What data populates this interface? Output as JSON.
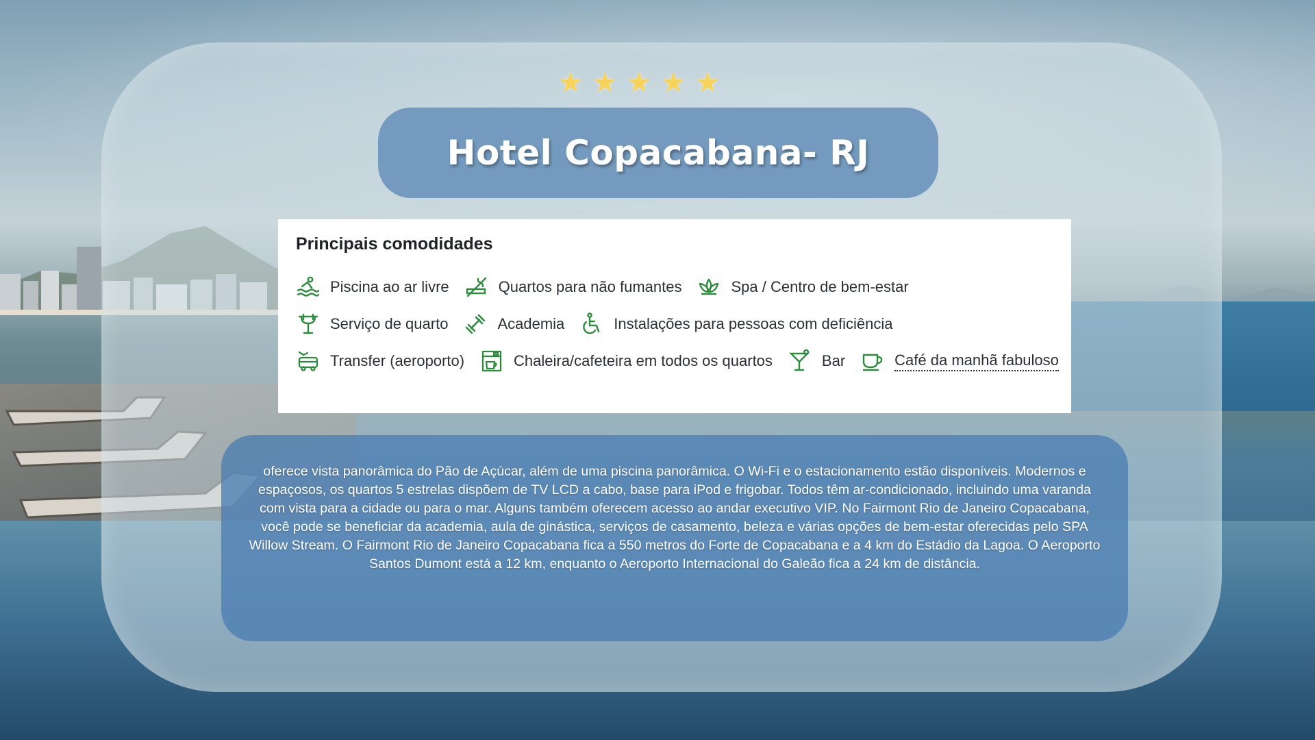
{
  "rating": {
    "stars": 5
  },
  "hotel": {
    "title": "Hotel Copacabana- RJ"
  },
  "amenities": {
    "heading": "Principais comodidades",
    "rows": [
      [
        {
          "icon": "pool-icon",
          "label": "Piscina ao ar livre"
        },
        {
          "icon": "no-smoking-icon",
          "label": "Quartos para não fumantes"
        },
        {
          "icon": "spa-lotus-icon",
          "label": "Spa / Centro de bem-estar"
        }
      ],
      [
        {
          "icon": "room-service-icon",
          "label": "Serviço de quarto"
        },
        {
          "icon": "dumbbell-icon",
          "label": "Academia"
        },
        {
          "icon": "wheelchair-icon",
          "label": "Instalações para pessoas com deficiência"
        }
      ],
      [
        {
          "icon": "airport-shuttle-icon",
          "label": "Transfer (aeroporto)"
        },
        {
          "icon": "coffee-maker-icon",
          "label": "Chaleira/cafeteira em todos os quartos"
        },
        {
          "icon": "cocktail-icon",
          "label": "Bar"
        },
        {
          "icon": "coffee-cup-icon",
          "label": "Café da manhã fabuloso"
        }
      ]
    ]
  },
  "description": {
    "text": "oferece vista panorâmica do Pão de Açúcar, além de uma piscina panorâmica. O Wi-Fi e o estacionamento estão disponíveis. Modernos e espaçosos, os quartos 5 estrelas dispõem de TV LCD a cabo, base para iPod e frigobar. Todos têm ar-condicionado, incluindo uma varanda com vista para a cidade ou para o mar. Alguns também oferecem acesso ao andar executivo VIP. No Fairmont Rio de Janeiro Copacabana, você pode se beneficiar da academia, aula de ginástica, serviços de casamento, beleza e várias opções de bem-estar oferecidas pelo SPA Willow Stream. O Fairmont Rio de Janeiro Copacabana fica a 550 metros do Forte de Copacabana e a 4 km do Estádio da Lagoa. O Aeroporto Santos Dumont está a 12 km, enquanto o Aeroporto Internacional do Galeão fica a 24 km de distância."
  },
  "colors": {
    "star": "#f7d35a",
    "title_pill": "#6c96bc",
    "icon_green": "#2e8b3e",
    "description_box": "#4c7db2"
  }
}
